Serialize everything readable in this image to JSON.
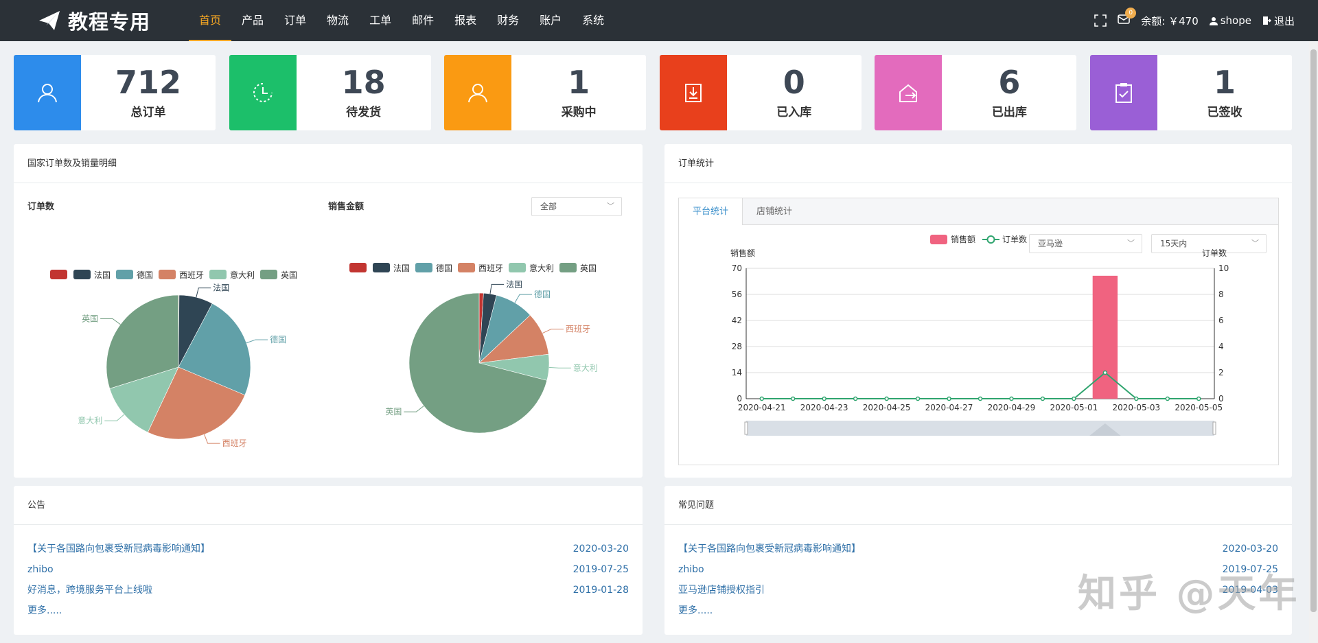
{
  "header": {
    "logo_text": "教程专用",
    "nav": [
      "首页",
      "产品",
      "订单",
      "物流",
      "工单",
      "邮件",
      "报表",
      "财务",
      "账户",
      "系统"
    ],
    "active_nav": 0,
    "mail_count": "0",
    "balance": "余额: ￥470",
    "username": "shope",
    "logout": "退出"
  },
  "stats": [
    {
      "value": "712",
      "label": "总订单",
      "color": "#2d8ceb",
      "icon": "user-icon"
    },
    {
      "value": "18",
      "label": "待发货",
      "color": "#1cbf6a",
      "icon": "clock-icon"
    },
    {
      "value": "1",
      "label": "采购中",
      "color": "#fa9a12",
      "icon": "user-icon"
    },
    {
      "value": "0",
      "label": "已入库",
      "color": "#e8401c",
      "icon": "download-box-icon"
    },
    {
      "value": "6",
      "label": "已出库",
      "color": "#e36bbd",
      "icon": "export-house-icon"
    },
    {
      "value": "1",
      "label": "已签收",
      "color": "#9a5fd6",
      "icon": "clipboard-check-icon"
    }
  ],
  "country_panel": {
    "title": "国家订单数及销量明细",
    "orders_title": "订单数",
    "sales_title": "销售金额",
    "filter": "全部",
    "legend": [
      "",
      "法国",
      "德国",
      "西班牙",
      "意大利",
      "英国"
    ]
  },
  "stats_panel": {
    "title": "订单统计",
    "tabs": [
      "平台统计",
      "店铺统计"
    ],
    "legend_sales": "销售额",
    "legend_orders": "订单数",
    "platform": "亚马逊",
    "range": "15天内",
    "y_left_title": "销售额",
    "y_right_title": "订单数"
  },
  "notice_panel": {
    "title": "公告",
    "items": [
      {
        "text": "【关于各国路向包裹受新冠病毒影响通知】",
        "date": "2020-03-20"
      },
      {
        "text": "zhibo",
        "date": "2019-07-25"
      },
      {
        "text": "好消息，跨境服务平台上线啦",
        "date": "2019-01-28"
      }
    ],
    "more": "更多....."
  },
  "faq_panel": {
    "title": "常见问题",
    "items": [
      {
        "text": "【关于各国路向包裹受新冠病毒影响通知】",
        "date": "2020-03-20"
      },
      {
        "text": "zhibo",
        "date": "2019-07-25"
      },
      {
        "text": "亚马逊店铺授权指引",
        "date": "2019-04-03"
      }
    ],
    "more": "更多....."
  },
  "watermark": "知乎 @天年",
  "chart_data": [
    {
      "type": "pie",
      "title": "订单数",
      "categories": [
        "",
        "法国",
        "德国",
        "西班牙",
        "意大利",
        "英国"
      ],
      "values": [
        1,
        55,
        170,
        185,
        95,
        215
      ],
      "colors": [
        "#c23531",
        "#2f4554",
        "#61a0a8",
        "#d48265",
        "#91c7ae",
        "#749f83"
      ],
      "slice_labels": [
        "",
        "法国",
        "德国",
        "西班牙",
        "意大利",
        "英国"
      ]
    },
    {
      "type": "pie",
      "title": "销售金额",
      "categories": [
        "",
        "法国",
        "德国",
        "西班牙",
        "意大利",
        "英国"
      ],
      "values": [
        1,
        3,
        9,
        10,
        6,
        71
      ],
      "colors": [
        "#c23531",
        "#2f4554",
        "#61a0a8",
        "#d48265",
        "#91c7ae",
        "#749f83"
      ],
      "slice_labels": [
        "",
        "法国",
        "德国",
        "西班牙",
        "意大利",
        "英国"
      ]
    },
    {
      "type": "bar",
      "x": [
        "2020-04-21",
        "2020-04-22",
        "2020-04-23",
        "2020-04-24",
        "2020-04-25",
        "2020-04-26",
        "2020-04-27",
        "2020-04-28",
        "2020-04-29",
        "2020-04-30",
        "2020-05-01",
        "2020-05-02",
        "2020-05-03",
        "2020-05-04",
        "2020-05-05"
      ],
      "x_tick_labels": [
        "2020-04-21",
        "2020-04-23",
        "2020-04-25",
        "2020-04-27",
        "2020-04-29",
        "2020-05-01",
        "2020-05-03",
        "2020-05-05"
      ],
      "series": [
        {
          "name": "销售额",
          "type": "bar",
          "axis": "left",
          "values": [
            0,
            0,
            0,
            0,
            0,
            0,
            0,
            0,
            0,
            0,
            0,
            66,
            0,
            0,
            0
          ],
          "color": "#f06380"
        },
        {
          "name": "订单数",
          "type": "line",
          "axis": "right",
          "values": [
            0,
            0,
            0,
            0,
            0,
            0,
            0,
            0,
            0,
            0,
            0,
            2,
            0,
            0,
            0
          ],
          "color": "#2fa46e"
        }
      ],
      "ylabel_left": "销售额",
      "ylabel_right": "订单数",
      "ylim_left": [
        0,
        70
      ],
      "ylim_right": [
        0,
        10
      ],
      "yticks_left": [
        "0",
        "14",
        "28",
        "42",
        "56",
        "70"
      ],
      "yticks_right": [
        "0",
        "2",
        "4",
        "6",
        "8",
        "10"
      ],
      "grid": true
    }
  ]
}
